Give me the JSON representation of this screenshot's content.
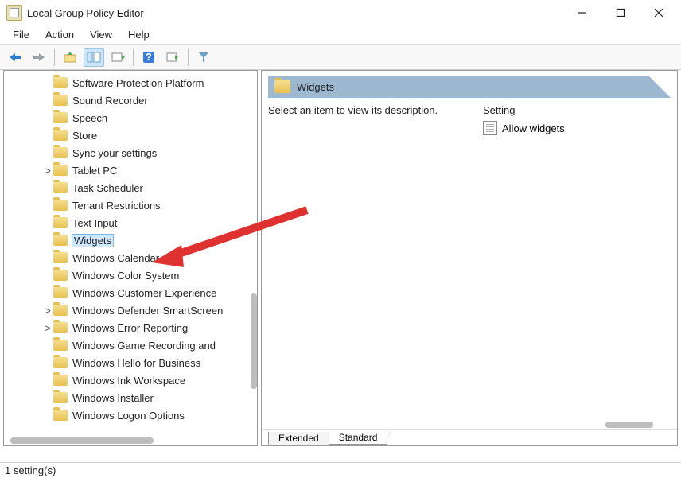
{
  "window": {
    "title": "Local Group Policy Editor"
  },
  "menu": {
    "file": "File",
    "action": "Action",
    "view": "View",
    "help": "Help"
  },
  "tree": {
    "items": [
      {
        "label": "Software Protection Platform",
        "expandable": false
      },
      {
        "label": "Sound Recorder",
        "expandable": false
      },
      {
        "label": "Speech",
        "expandable": false
      },
      {
        "label": "Store",
        "expandable": false
      },
      {
        "label": "Sync your settings",
        "expandable": false
      },
      {
        "label": "Tablet PC",
        "expandable": true
      },
      {
        "label": "Task Scheduler",
        "expandable": false
      },
      {
        "label": "Tenant Restrictions",
        "expandable": false
      },
      {
        "label": "Text Input",
        "expandable": false
      },
      {
        "label": "Widgets",
        "expandable": false,
        "selected": true
      },
      {
        "label": "Windows Calendar",
        "expandable": false
      },
      {
        "label": "Windows Color System",
        "expandable": false
      },
      {
        "label": "Windows Customer Experience",
        "expandable": false
      },
      {
        "label": "Windows Defender SmartScreen",
        "expandable": true
      },
      {
        "label": "Windows Error Reporting",
        "expandable": true
      },
      {
        "label": "Windows Game Recording and",
        "expandable": false
      },
      {
        "label": "Windows Hello for Business",
        "expandable": false
      },
      {
        "label": "Windows Ink Workspace",
        "expandable": false
      },
      {
        "label": "Windows Installer",
        "expandable": false
      },
      {
        "label": "Windows Logon Options",
        "expandable": false
      }
    ]
  },
  "right": {
    "title": "Widgets",
    "description": "Select an item to view its description.",
    "column": "Setting",
    "settings": [
      {
        "label": "Allow widgets"
      }
    ],
    "tabs": {
      "extended": "Extended",
      "standard": "Standard"
    }
  },
  "status": {
    "text": "1 setting(s)"
  }
}
